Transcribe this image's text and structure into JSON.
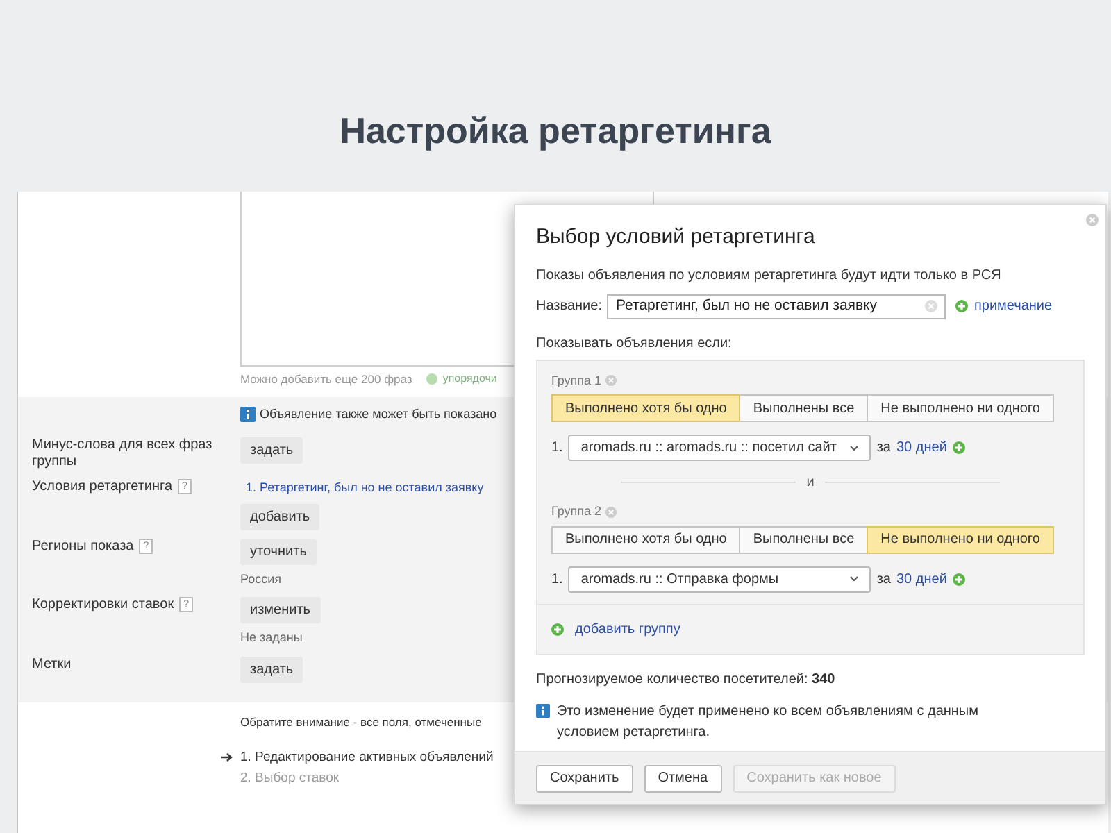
{
  "slide": {
    "title": "Настройка ретаргетинга"
  },
  "page": {
    "phrases_hint": "Можно добавить еще 200 фраз",
    "sort_link": "упорядочи",
    "notice": "Объявление также может быть показано",
    "rows": [
      {
        "label": "Минус-слова для всех фраз группы",
        "button": "задать"
      },
      {
        "label": "Условия ретаргетинга",
        "help": "?",
        "link": "1. Ретаргетинг, был но не оставил заявку",
        "button": "добавить"
      },
      {
        "label": "Регионы показа",
        "help": "?",
        "button": "уточнить",
        "note": "Россия"
      },
      {
        "label": "Корректировки ставок",
        "help": "?",
        "button": "изменить",
        "note": "Не заданы"
      },
      {
        "label": "Метки",
        "button": "задать"
      }
    ],
    "footer_note": "Обратите внимание - все поля, отмеченные",
    "steps": [
      {
        "text": "1. Редактирование активных объявлений",
        "selected": true
      },
      {
        "text": "2. Выбор ставок",
        "selected": false
      }
    ]
  },
  "dialog": {
    "title": "Выбор условий ретаргетинга",
    "subtitle": "Показы объявления по условиям ретаргетинга будут идти только в РСЯ",
    "name_label": "Название:",
    "name_value": "Ретаргетинг, был но не оставил заявку",
    "note_link": "примечание",
    "show_if": "Показывать объявления если:",
    "groups": [
      {
        "title": "Группа 1",
        "modes": [
          {
            "label": "Выполнено хотя бы одно",
            "selected": true
          },
          {
            "label": "Выполнены все",
            "selected": false
          },
          {
            "label": "Не выполнено ни одного",
            "selected": false
          }
        ],
        "conditions": [
          {
            "number": "1.",
            "value": "aromads.ru :: aromads.ru :: посетил сайт",
            "period_prefix": "за",
            "period": "30 дней"
          }
        ]
      },
      {
        "title": "Группа 2",
        "modes": [
          {
            "label": "Выполнено хотя бы одно",
            "selected": false
          },
          {
            "label": "Выполнены все",
            "selected": false
          },
          {
            "label": "Не выполнено ни одного",
            "selected": true
          }
        ],
        "conditions": [
          {
            "number": "1.",
            "value": "aromads.ru :: Отправка формы",
            "period_prefix": "за",
            "period": "30 дней"
          }
        ]
      }
    ],
    "separator": "и",
    "add_group": "добавить группу",
    "forecast": "Прогнозируемое количество посетителей: **340**",
    "info": "Это изменение будет применено ко всем объявлениям с данным условием ретаргетинга.",
    "buttons": [
      {
        "label": "Сохранить",
        "disabled": false
      },
      {
        "label": "Отмена",
        "disabled": false
      },
      {
        "label": "Сохранить как новое",
        "disabled": true
      }
    ]
  }
}
